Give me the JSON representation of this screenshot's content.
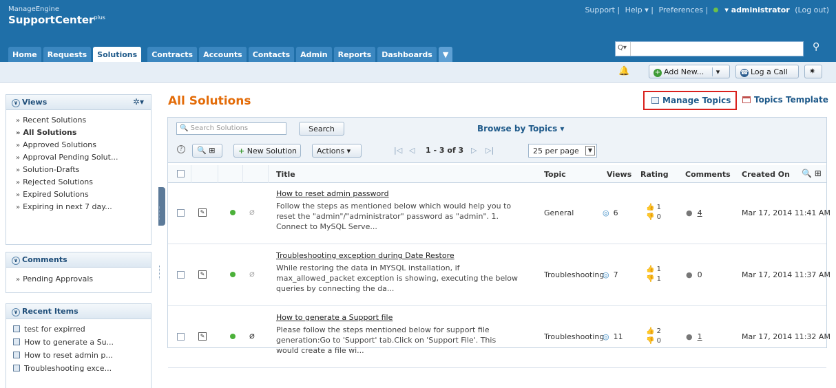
{
  "header": {
    "brand_small": "ManageEngine",
    "brand_name": "SupportCenter",
    "brand_sup": "plus",
    "links": {
      "support": "Support",
      "help": "Help ▾",
      "preferences": "Preferences",
      "user": "▾ administrator",
      "logout": "(Log out)"
    }
  },
  "nav": {
    "tabs": [
      "Home",
      "Requests",
      "Solutions",
      "Contracts",
      "Accounts",
      "Contacts",
      "Admin",
      "Reports",
      "Dashboards"
    ],
    "active": "Solutions",
    "more": "▼",
    "search_selector": "Q▾",
    "go": "Go"
  },
  "toolbar": {
    "add_new": "Add New...",
    "add_new_arrow": "▾",
    "log_call": "Log a Call"
  },
  "views_panel": {
    "title": "Views",
    "items": [
      "Recent Solutions",
      "All Solutions",
      "Approved Solutions",
      "Approval Pending Solut...",
      "Solution-Drafts",
      "Rejected Solutions",
      "Expired Solutions",
      "Expiring in next 7 day..."
    ]
  },
  "comments_panel": {
    "title": "Comments",
    "items": [
      "Pending Approvals"
    ]
  },
  "recent_panel": {
    "title": "Recent Items",
    "items": [
      "test for expirred",
      "How to generate a Su...",
      "How to reset admin p...",
      "Troubleshooting exce..."
    ]
  },
  "main": {
    "title": "All Solutions",
    "manage_topics": "Manage Topics",
    "topics_template": "Topics Template",
    "search_placeholder": "Search Solutions",
    "search_button": "Search",
    "browse": "Browse by Topics ▾",
    "new_solution": "New Solution",
    "actions": "Actions ▾",
    "pagination": "1 - 3 of 3",
    "per_page": "25 per page"
  },
  "table": {
    "columns": {
      "title": "Title",
      "topic": "Topic",
      "views": "Views",
      "rating": "Rating",
      "comments": "Comments",
      "created": "Created On"
    },
    "rows": [
      {
        "title": "How to reset admin password",
        "desc": "Follow the steps as mentioned below which would help you to reset the \"admin\"/\"administrator\" password as \"admin\". 1. Connect to MySQL Serve...",
        "topic": "General",
        "views": "6",
        "up": "1",
        "down": "0",
        "comments": "4",
        "created": "Mar 17, 2014 11:41 AM"
      },
      {
        "title": "Troubleshooting exception during Date Restore",
        "desc": "While restoring the data in MYSQL installation, if max_allowed_packet exception is showing, executing the below queries by connecting the da...",
        "topic": "Troubleshooting",
        "views": "7",
        "up": "1",
        "down": "1",
        "comments": "0",
        "created": "Mar 17, 2014 11:37 AM"
      },
      {
        "title": "How to generate a Support file",
        "desc": "Please follow the steps mentioned below for support file generation:Go to 'Support' tab.Click on 'Support File'. This would create a file wi...",
        "topic": "Troubleshooting",
        "views": "11",
        "up": "2",
        "down": "0",
        "comments": "1",
        "created": "Mar 17, 2014 11:32 AM"
      }
    ]
  }
}
